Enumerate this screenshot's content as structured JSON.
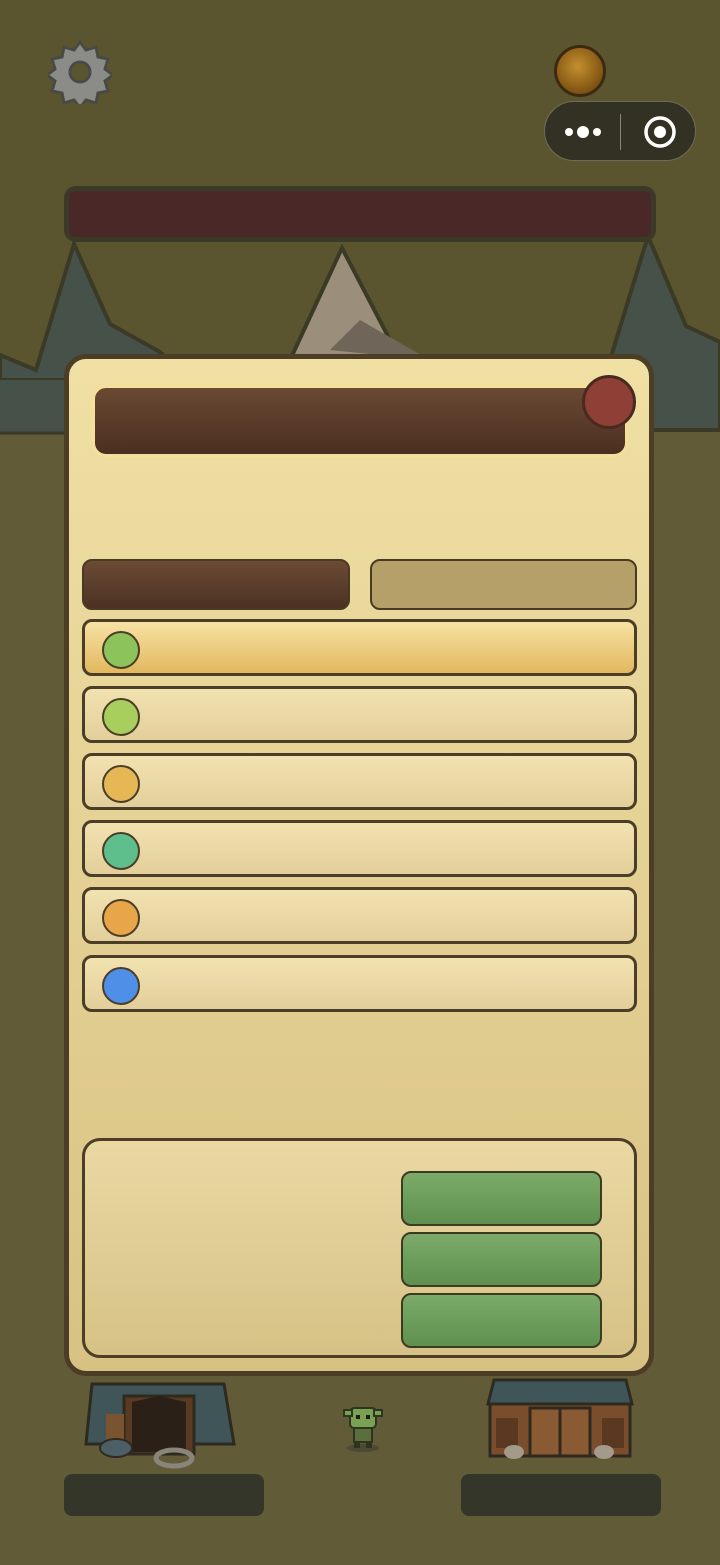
{
  "hud": {
    "settings_icon": "gear-icon",
    "coin_icon": "coin-icon",
    "capsule": {
      "menu_icon": "more-dots-icon",
      "target_icon": "record-target-icon"
    },
    "top_bar_text": ""
  },
  "dialog": {
    "title": "",
    "close_icon": "close-icon",
    "tabs": [
      {
        "label": "",
        "active": true
      },
      {
        "label": "",
        "active": false
      }
    ],
    "rows": [
      {
        "label": "",
        "dot_color": "#8cc35a",
        "selected": true
      },
      {
        "label": "",
        "dot_color": "#a8cf5e",
        "selected": false
      },
      {
        "label": "",
        "dot_color": "#e6b855",
        "selected": false
      },
      {
        "label": "",
        "dot_color": "#5fbf8c",
        "selected": false
      },
      {
        "label": "",
        "dot_color": "#e8a64a",
        "selected": false
      },
      {
        "label": "",
        "dot_color": "#4f8fe8",
        "selected": false
      }
    ],
    "info_text": "",
    "actions": [
      {
        "label": ""
      },
      {
        "label": ""
      },
      {
        "label": ""
      }
    ]
  },
  "scene": {
    "left_building": "tent-icon",
    "right_building": "barn-icon",
    "character": "goblin-icon"
  },
  "footer": {
    "left_button": "",
    "right_button": ""
  },
  "colors": {
    "panel": "#e8d596",
    "panel_border": "#4b3d26",
    "title_bar": "#5a3b2a",
    "tab_inactive": "#b6a06a",
    "action_green": "#6b9a58",
    "close": "#8e4036"
  }
}
